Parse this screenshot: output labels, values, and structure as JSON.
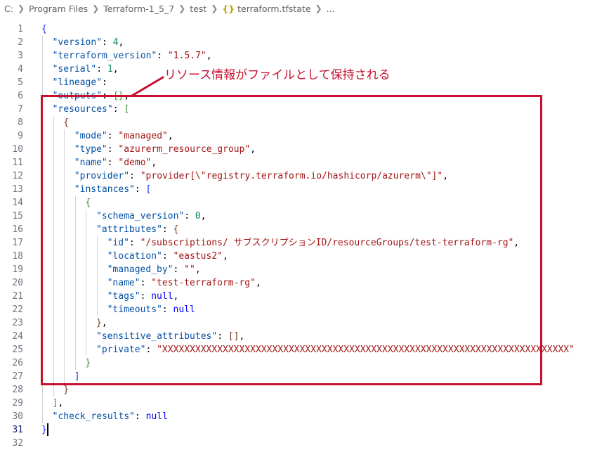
{
  "breadcrumb": {
    "items": [
      "C:",
      "Program Files",
      "Terraform-1_5_7",
      "test",
      "terraform.tfstate",
      "..."
    ],
    "file_icon": "json-braces-icon"
  },
  "annotation": {
    "text": "リソース情報がファイルとして保持される",
    "color": "#c8102e"
  },
  "editor": {
    "active_line": 31,
    "lines": [
      {
        "n": "1",
        "indent": 0,
        "t": [
          [
            "b1",
            "{"
          ]
        ]
      },
      {
        "n": "2",
        "indent": 1,
        "t": [
          [
            "k",
            "\"version\""
          ],
          [
            "p",
            ": "
          ],
          [
            "n",
            "4"
          ],
          [
            "p",
            ","
          ]
        ]
      },
      {
        "n": "3",
        "indent": 1,
        "t": [
          [
            "k",
            "\"terraform_version\""
          ],
          [
            "p",
            ": "
          ],
          [
            "s",
            "\"1.5.7\""
          ],
          [
            "p",
            ","
          ]
        ]
      },
      {
        "n": "4",
        "indent": 1,
        "t": [
          [
            "k",
            "\"serial\""
          ],
          [
            "p",
            ": "
          ],
          [
            "n",
            "1"
          ],
          [
            "p",
            ","
          ]
        ]
      },
      {
        "n": "5",
        "indent": 1,
        "t": [
          [
            "k",
            "\"lineage\""
          ],
          [
            "p",
            ":"
          ]
        ]
      },
      {
        "n": "6",
        "indent": 1,
        "t": [
          [
            "k",
            "\"outputs\""
          ],
          [
            "p",
            ": "
          ],
          [
            "b2",
            "{}"
          ],
          [
            "p",
            ","
          ]
        ]
      },
      {
        "n": "7",
        "indent": 1,
        "t": [
          [
            "k",
            "\"resources\""
          ],
          [
            "p",
            ": "
          ],
          [
            "b2",
            "["
          ]
        ]
      },
      {
        "n": "8",
        "indent": 2,
        "t": [
          [
            "b3",
            "{"
          ]
        ]
      },
      {
        "n": "9",
        "indent": 3,
        "t": [
          [
            "k",
            "\"mode\""
          ],
          [
            "p",
            ": "
          ],
          [
            "s",
            "\"managed\""
          ],
          [
            "p",
            ","
          ]
        ]
      },
      {
        "n": "10",
        "indent": 3,
        "t": [
          [
            "k",
            "\"type\""
          ],
          [
            "p",
            ": "
          ],
          [
            "s",
            "\"azurerm_resource_group\""
          ],
          [
            "p",
            ","
          ]
        ]
      },
      {
        "n": "11",
        "indent": 3,
        "t": [
          [
            "k",
            "\"name\""
          ],
          [
            "p",
            ": "
          ],
          [
            "s",
            "\"demo\""
          ],
          [
            "p",
            ","
          ]
        ]
      },
      {
        "n": "12",
        "indent": 3,
        "t": [
          [
            "k",
            "\"provider\""
          ],
          [
            "p",
            ": "
          ],
          [
            "s",
            "\"provider[\\\"registry.terraform.io/hashicorp/azurerm\\\"]\""
          ],
          [
            "p",
            ","
          ]
        ]
      },
      {
        "n": "13",
        "indent": 3,
        "t": [
          [
            "k",
            "\"instances\""
          ],
          [
            "p",
            ": "
          ],
          [
            "b1",
            "["
          ]
        ]
      },
      {
        "n": "14",
        "indent": 4,
        "t": [
          [
            "b2",
            "{"
          ]
        ]
      },
      {
        "n": "15",
        "indent": 5,
        "t": [
          [
            "k",
            "\"schema_version\""
          ],
          [
            "p",
            ": "
          ],
          [
            "n",
            "0"
          ],
          [
            "p",
            ","
          ]
        ]
      },
      {
        "n": "16",
        "indent": 5,
        "t": [
          [
            "k",
            "\"attributes\""
          ],
          [
            "p",
            ": "
          ],
          [
            "b3",
            "{"
          ]
        ]
      },
      {
        "n": "17",
        "indent": 6,
        "t": [
          [
            "k",
            "\"id\""
          ],
          [
            "p",
            ": "
          ],
          [
            "s",
            "\"/subscriptions/ サブスクリプションID/resourceGroups/test-terraform-rg\""
          ],
          [
            "p",
            ","
          ]
        ]
      },
      {
        "n": "18",
        "indent": 6,
        "t": [
          [
            "k",
            "\"location\""
          ],
          [
            "p",
            ": "
          ],
          [
            "s",
            "\"eastus2\""
          ],
          [
            "p",
            ","
          ]
        ]
      },
      {
        "n": "19",
        "indent": 6,
        "t": [
          [
            "k",
            "\"managed_by\""
          ],
          [
            "p",
            ": "
          ],
          [
            "s",
            "\"\""
          ],
          [
            "p",
            ","
          ]
        ]
      },
      {
        "n": "20",
        "indent": 6,
        "t": [
          [
            "k",
            "\"name\""
          ],
          [
            "p",
            ": "
          ],
          [
            "s",
            "\"test-terraform-rg\""
          ],
          [
            "p",
            ","
          ]
        ]
      },
      {
        "n": "21",
        "indent": 6,
        "t": [
          [
            "k",
            "\"tags\""
          ],
          [
            "p",
            ": "
          ],
          [
            "kw",
            "null"
          ],
          [
            "p",
            ","
          ]
        ]
      },
      {
        "n": "22",
        "indent": 6,
        "t": [
          [
            "k",
            "\"timeouts\""
          ],
          [
            "p",
            ": "
          ],
          [
            "kw",
            "null"
          ]
        ]
      },
      {
        "n": "23",
        "indent": 5,
        "t": [
          [
            "b3",
            "}"
          ],
          [
            "p",
            ","
          ]
        ]
      },
      {
        "n": "24",
        "indent": 5,
        "t": [
          [
            "k",
            "\"sensitive_attributes\""
          ],
          [
            "p",
            ": "
          ],
          [
            "b3",
            "[]"
          ],
          [
            "p",
            ","
          ]
        ]
      },
      {
        "n": "25",
        "indent": 5,
        "t": [
          [
            "k",
            "\"private\""
          ],
          [
            "p",
            ": "
          ],
          [
            "s",
            "\"XXXXXXXXXXXXXXXXXXXXXXXXXXXXXXXXXXXXXXXXXXXXXXXXXXXXXXXXXXXXXXXXXXXXXXXXXX\""
          ]
        ]
      },
      {
        "n": "26",
        "indent": 4,
        "t": [
          [
            "b2",
            "}"
          ]
        ]
      },
      {
        "n": "27",
        "indent": 3,
        "t": [
          [
            "b1",
            "]"
          ]
        ]
      },
      {
        "n": "28",
        "indent": 2,
        "t": [
          [
            "b3",
            "}"
          ]
        ]
      },
      {
        "n": "29",
        "indent": 1,
        "t": [
          [
            "b2",
            "]"
          ],
          [
            "p",
            ","
          ]
        ]
      },
      {
        "n": "30",
        "indent": 1,
        "t": [
          [
            "k",
            "\"check_results\""
          ],
          [
            "p",
            ": "
          ],
          [
            "kw",
            "null"
          ]
        ]
      },
      {
        "n": "31",
        "indent": 0,
        "t": [
          [
            "b1",
            "}"
          ]
        ]
      },
      {
        "n": "32",
        "indent": 0,
        "t": []
      }
    ]
  }
}
